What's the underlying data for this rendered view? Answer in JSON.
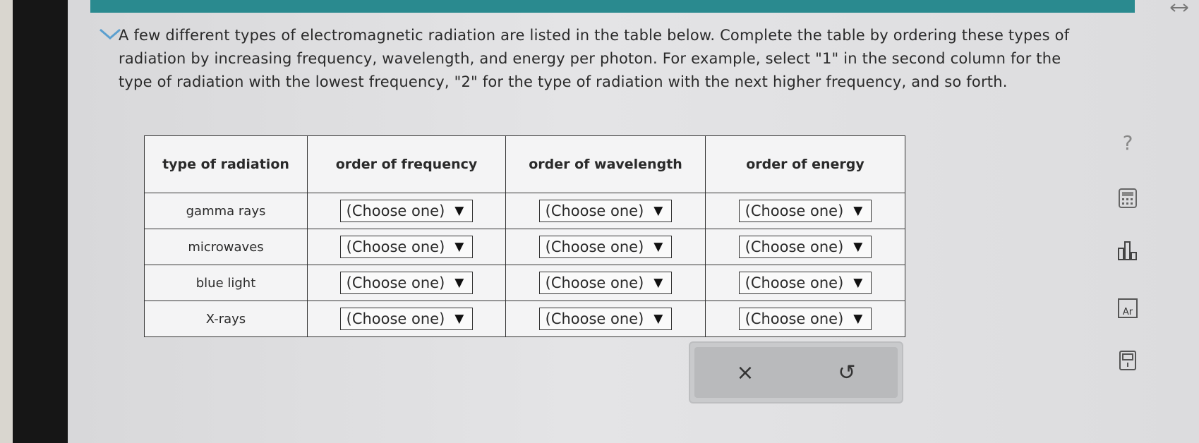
{
  "question": {
    "lines": [
      "A few different types of electromagnetic radiation are listed in the table below. Complete the table by ordering these types of",
      "radiation by increasing frequency, wavelength, and energy per photon. For example, select \"1\" in the second column for the",
      "type of radiation with the lowest frequency, \"2\" for the type of radiation with the next higher frequency, and so forth."
    ]
  },
  "table": {
    "headers": [
      "type of radiation",
      "order of frequency",
      "order of wavelength",
      "order of energy"
    ],
    "rows": [
      {
        "type": "gamma rays",
        "frequency": "(Choose one)",
        "wavelength": "(Choose one)",
        "energy": "(Choose one)"
      },
      {
        "type": "microwaves",
        "frequency": "(Choose one)",
        "wavelength": "(Choose one)",
        "energy": "(Choose one)"
      },
      {
        "type": "blue light",
        "frequency": "(Choose one)",
        "wavelength": "(Choose one)",
        "energy": "(Choose one)"
      },
      {
        "type": "X-rays",
        "frequency": "(Choose one)",
        "wavelength": "(Choose one)",
        "energy": "(Choose one)"
      }
    ],
    "dropdown_arrow": "▼"
  },
  "actions": {
    "clear_symbol": "×",
    "undo_symbol": "↺"
  },
  "tools": {
    "help_symbol": "?",
    "periodic_label": "Ar"
  },
  "icons": {
    "collapse": "chevron-down-icon",
    "resize": "resize-icon",
    "calculator": "calculator-icon",
    "chart": "bar-chart-icon",
    "periodic": "periodic-table-icon",
    "book": "reference-book-icon"
  },
  "colors": {
    "topbar": "#2a8a8f",
    "screen_bg": "#e2e2e4",
    "accent_chevron": "#5a9fcf"
  }
}
